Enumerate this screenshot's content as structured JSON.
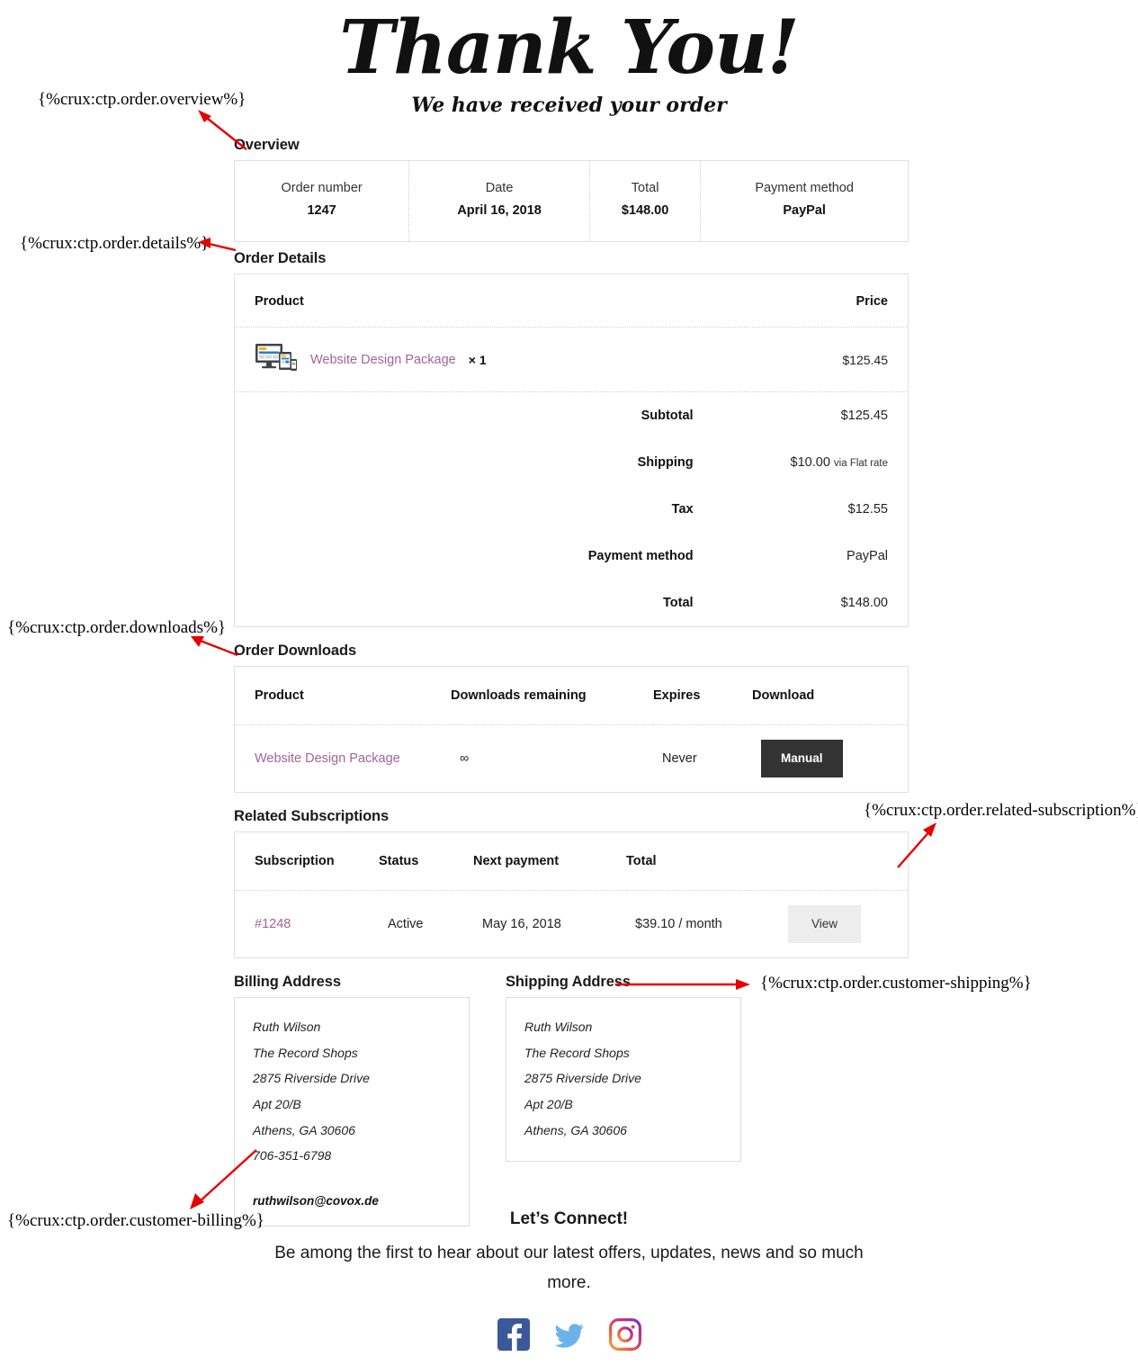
{
  "hero": {
    "title": "Thank You!",
    "subtitle": "We have received your order"
  },
  "annotations": {
    "overview": "{%crux:ctp.order.overview%}",
    "details": "{%crux:ctp.order.details%}",
    "downloads": "{%crux:ctp.order.downloads%}",
    "related_subscription": "{%crux:ctp.order.related-subscription%}",
    "customer_shipping": "{%crux:ctp.order.customer-shipping%}",
    "customer_billing": "{%crux:ctp.order.customer-billing%}",
    "arrow_color": "#e60000"
  },
  "overview": {
    "heading": "Overview",
    "cells": [
      {
        "label": "Order number",
        "value": "1247"
      },
      {
        "label": "Date",
        "value": "April 16, 2018"
      },
      {
        "label": "Total",
        "value": "$148.00"
      },
      {
        "label": "Payment method",
        "value": "PayPal"
      }
    ]
  },
  "order_details": {
    "heading": "Order Details",
    "columns": {
      "product": "Product",
      "price": "Price"
    },
    "items": [
      {
        "name": "Website Design Package",
        "qty": "× 1",
        "price": "$125.45",
        "thumb": "responsive-devices-image"
      }
    ],
    "totals": [
      {
        "label": "Subtotal",
        "value": "$125.45",
        "note": ""
      },
      {
        "label": "Shipping",
        "value": "$10.00",
        "note": "via Flat rate"
      },
      {
        "label": "Tax",
        "value": "$12.55",
        "note": ""
      },
      {
        "label": "Payment method",
        "value": "PayPal",
        "note": ""
      },
      {
        "label": "Total",
        "value": "$148.00",
        "note": ""
      }
    ]
  },
  "order_downloads": {
    "heading": "Order Downloads",
    "columns": [
      "Product",
      "Downloads remaining",
      "Expires",
      "Download"
    ],
    "rows": [
      {
        "product": "Website Design Package",
        "remaining": "∞",
        "expires": "Never",
        "button": "Manual"
      }
    ]
  },
  "related_subscriptions": {
    "heading": "Related Subscriptions",
    "columns": [
      "Subscription",
      "Status",
      "Next payment",
      "Total",
      ""
    ],
    "rows": [
      {
        "subscription": "#1248",
        "status": "Active",
        "next_payment": "May 16, 2018",
        "total": "$39.10 / month",
        "button": "View"
      }
    ]
  },
  "billing_address": {
    "heading": "Billing Address",
    "lines": [
      "Ruth Wilson",
      "The Record Shops",
      "2875 Riverside Drive",
      "Apt 20/B",
      "Athens, GA 30606",
      "706-351-6798"
    ],
    "email": "ruthwilson@covox.de"
  },
  "shipping_address": {
    "heading": "Shipping Address",
    "lines": [
      "Ruth Wilson",
      "The Record Shops",
      "2875 Riverside Drive",
      "Apt 20/B",
      "Athens, GA 30606"
    ]
  },
  "footer": {
    "title": "Let’s Connect!",
    "text": "Be among the first to hear about our latest offers, updates, news and so much more.",
    "socials": [
      {
        "name": "facebook-icon",
        "color": "#3b5998"
      },
      {
        "name": "twitter-icon",
        "color": "#6cb2ea"
      },
      {
        "name": "instagram-icon",
        "color": "#c13584"
      }
    ]
  },
  "colors": {
    "link": "#a46497",
    "button_dark": "#333333",
    "button_light": "#ededed",
    "border": "#e0e0e0"
  }
}
